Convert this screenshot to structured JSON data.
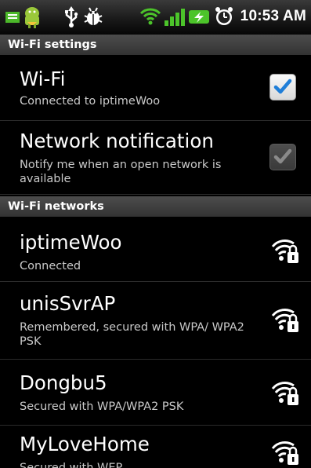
{
  "status_bar": {
    "time": "10:53 AM",
    "icons": [
      "notification-icon",
      "android-icon",
      "usb-icon",
      "debug-icon",
      "wifi-signal-icon",
      "cell-signal-icon",
      "battery-charging-icon",
      "alarm-icon"
    ]
  },
  "sections": {
    "wifi_settings": "Wi-Fi settings",
    "wifi_networks": "Wi-Fi networks"
  },
  "settings": {
    "wifi": {
      "title": "Wi-Fi",
      "summary": "Connected to iptimeWoo",
      "checked": true
    },
    "network_notification": {
      "title": "Network notification",
      "summary": "Notify me when an open network is available",
      "checked": true,
      "enabled": false
    }
  },
  "networks": [
    {
      "ssid": "iptimeWoo",
      "status": "Connected",
      "icon": "wifi-lock-icon"
    },
    {
      "ssid": "unisSvrAP",
      "status": "Remembered, secured with WPA/ WPA2 PSK",
      "icon": "wifi-lock-icon"
    },
    {
      "ssid": "Dongbu5",
      "status": "Secured with WPA/WPA2 PSK",
      "icon": "wifi-lock-icon"
    },
    {
      "ssid": "MyLoveHome",
      "status": "Secured with WEP",
      "icon": "wifi-lock-icon"
    }
  ],
  "colors": {
    "accent_check": "#1f7ed8",
    "section_header_bg": "#3d3d3d",
    "background": "#000000"
  }
}
